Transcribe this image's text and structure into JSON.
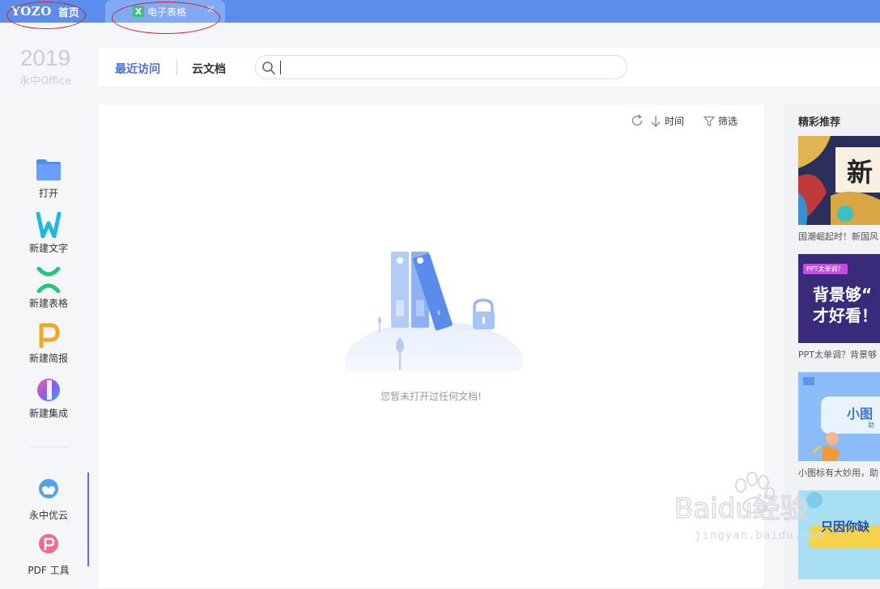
{
  "titlebar": {
    "logo": "YOZO",
    "home_label": "首页",
    "doc_tab_label": "电子表格",
    "doc_tab_icon": "X"
  },
  "sidebar": {
    "year": "2019",
    "brand": "永中Office",
    "items": [
      {
        "label": "打开",
        "icon": "folder-icon"
      },
      {
        "label": "新建文字",
        "icon": "writer-icon"
      },
      {
        "label": "新建表格",
        "icon": "sheet-icon"
      },
      {
        "label": "新建简报",
        "icon": "presentation-icon"
      },
      {
        "label": "新建集成",
        "icon": "integration-icon"
      },
      {
        "label": "永中优云",
        "icon": "cloud-icon"
      },
      {
        "label": "PDF 工具",
        "icon": "pdf-icon"
      }
    ]
  },
  "topbar": {
    "tab_recent": "最近访问",
    "tab_cloud": "云文档",
    "search_value": ""
  },
  "main": {
    "sort_label": "时间",
    "filter_label": "筛选",
    "empty_text": "您暂未打开过任何文档!"
  },
  "recs": {
    "title": "精彩推荐",
    "cards": [
      {
        "caption": "国潮崛起时！新国风",
        "img_text": "新"
      },
      {
        "caption": "PPT太单调？背景够",
        "img_text": "背景够“",
        "img_text2": "才好看！",
        "badge": "PPT太单调？"
      },
      {
        "caption": "小图标有大妙用，助",
        "img_text": "小图",
        "img_sub": "助"
      },
      {
        "caption": "",
        "img_text": "只因你缺"
      }
    ]
  },
  "watermark": {
    "main": "Baidu经验",
    "sub": "jingyan.baidu.com"
  },
  "colors": {
    "titlebar": "#5b8def",
    "accent": "#4a6fd9",
    "sheet_green": "#3cc07a"
  }
}
